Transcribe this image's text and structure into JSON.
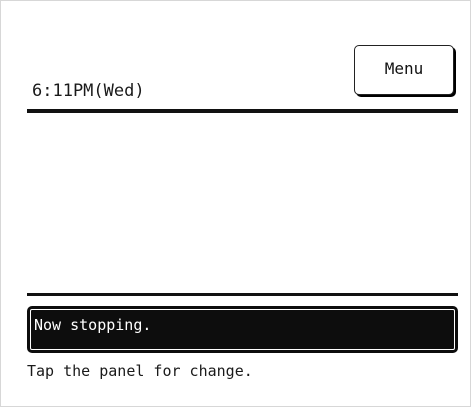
{
  "header": {
    "clock": "6:11PM(Wed)",
    "menu_label": "Menu"
  },
  "status": {
    "message": "Now stopping."
  },
  "footer": {
    "hint": "Tap the panel for change."
  }
}
